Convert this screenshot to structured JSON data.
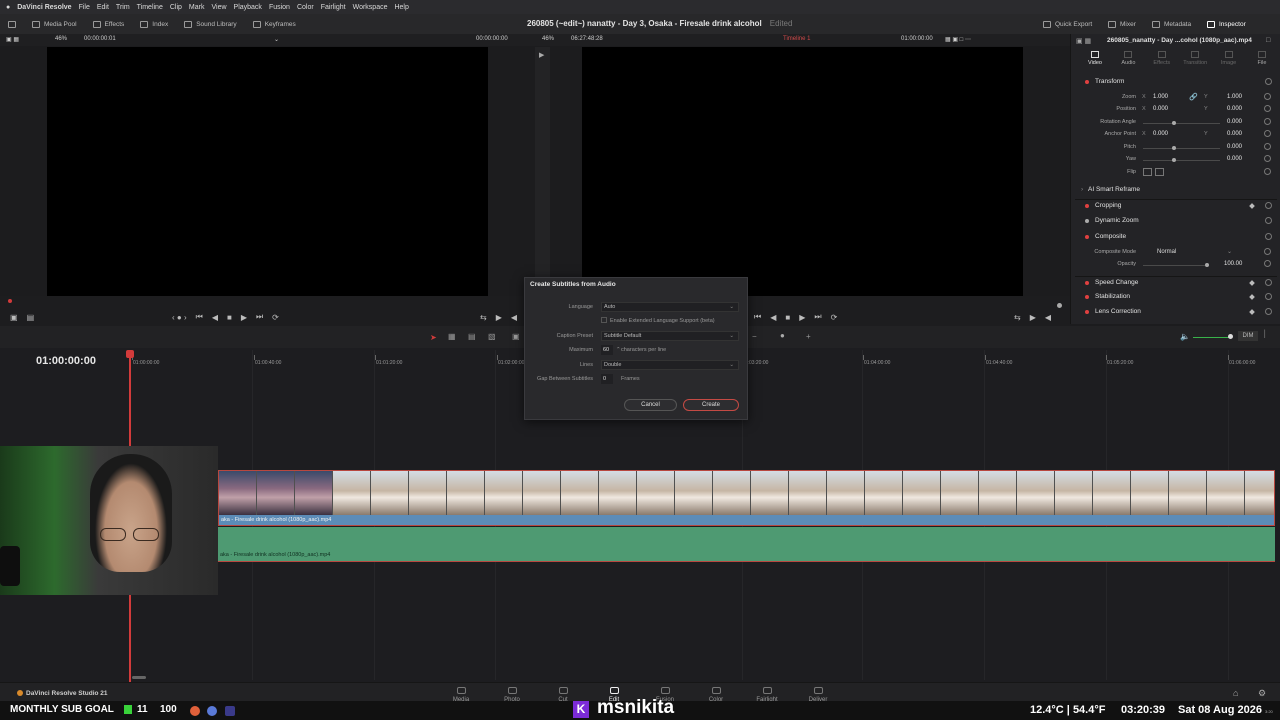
{
  "menubar": {
    "app": "DaVinci Resolve",
    "items": [
      "File",
      "Edit",
      "Trim",
      "Timeline",
      "Clip",
      "Mark",
      "View",
      "Playback",
      "Fusion",
      "Color",
      "Fairlight",
      "Workspace",
      "Help"
    ]
  },
  "toolbar": {
    "media_pool": "Media Pool",
    "effects": "Effects",
    "index": "Index",
    "sound_library": "Sound Library",
    "keyframes": "Keyframes",
    "title": "260805 (~edit~) nanatty - Day 3, Osaka - Firesale drink alcohol",
    "edited": "Edited",
    "quick_export": "Quick Export",
    "mixer": "Mixer",
    "metadata": "Metadata",
    "inspector": "Inspector"
  },
  "viewer_header": {
    "src_zoom": "46%",
    "src_tc": "00:00:00:01",
    "src_tc2": "00:00:00:00",
    "prg_zoom": "46%",
    "prg_dur": "06:27:48:28",
    "timeline_name": "Timeline 1",
    "prg_tc": "01:00:00:00"
  },
  "inspector": {
    "title": "260805_nanatty - Day ...cohol (1080p_aac).mp4",
    "tabs": [
      "Video",
      "Audio",
      "Effects",
      "Transition",
      "Image",
      "File"
    ],
    "transform": "Transform",
    "zoom": {
      "label": "Zoom",
      "x": "1.000",
      "y": "1.000"
    },
    "position": {
      "label": "Position",
      "x": "0.000",
      "y": "0.000"
    },
    "rotation": {
      "label": "Rotation Angle",
      "v": "0.000"
    },
    "anchor": {
      "label": "Anchor Point",
      "x": "0.000",
      "y": "0.000"
    },
    "pitch": {
      "label": "Pitch",
      "v": "0.000"
    },
    "yaw": {
      "label": "Yaw",
      "v": "0.000"
    },
    "flip": "Flip",
    "smart_reframe": "AI Smart Reframe",
    "cropping": "Cropping",
    "dynamic_zoom": "Dynamic Zoom",
    "composite": "Composite",
    "composite_mode_label": "Composite Mode",
    "composite_mode": "Normal",
    "opacity_label": "Opacity",
    "opacity": "100.00",
    "speed_change": "Speed Change",
    "stabilization": "Stabilization",
    "lens_correction": "Lens Correction",
    "x_label": "X",
    "y_label": "Y"
  },
  "dialog": {
    "title": "Create Subtitles from Audio",
    "language_label": "Language",
    "language": "Auto",
    "extended": "Enable Extended Language Support (beta)",
    "preset_label": "Caption Preset",
    "preset": "Subtitle Default",
    "maximum_label": "Maximum",
    "maximum": "60",
    "maximum_unit": "characters per line",
    "lines_label": "Lines",
    "lines": "Double",
    "gap_label": "Gap Between Subtitles",
    "gap": "0",
    "gap_unit": "Frames",
    "cancel": "Cancel",
    "create": "Create"
  },
  "timeline": {
    "timecode": "01:00:00:00",
    "ruler": [
      "01:00:00:00",
      "01:00:40:00",
      "01:01:20:00",
      "01:02:00:00",
      "01:03:20:00",
      "01:04:00:00",
      "01:04:40:00",
      "01:05:20:00",
      "01:06:00:00"
    ],
    "video_clip": "aka - Firesale drink alcohol (1080p_aac).mp4",
    "audio_clip": "aka - Firesale drink alcohol (1080p_aac).mp4",
    "dim": "DIM"
  },
  "pagebar": {
    "product": "DaVinci Resolve Studio 21",
    "pages": [
      "Media",
      "Photo",
      "Cut",
      "Edit",
      "Fusion",
      "Color",
      "Fairlight",
      "Deliver"
    ]
  },
  "overlay": {
    "sub_goal": "MONTHLY SUB GOAL",
    "current": "11",
    "target": "100",
    "handle": "msnikita",
    "weather": "12.4°C | 54.4°F",
    "clock": "03:20:39",
    "date": "Sat 08 Aug 2026",
    "mini_time": "3:20"
  },
  "colors": {
    "accent": "#d23b3b",
    "video_clip": "#5c8cb8",
    "audio_clip": "#4e9a72",
    "goal": "#39d23a",
    "kick": "#7c2bd8"
  }
}
